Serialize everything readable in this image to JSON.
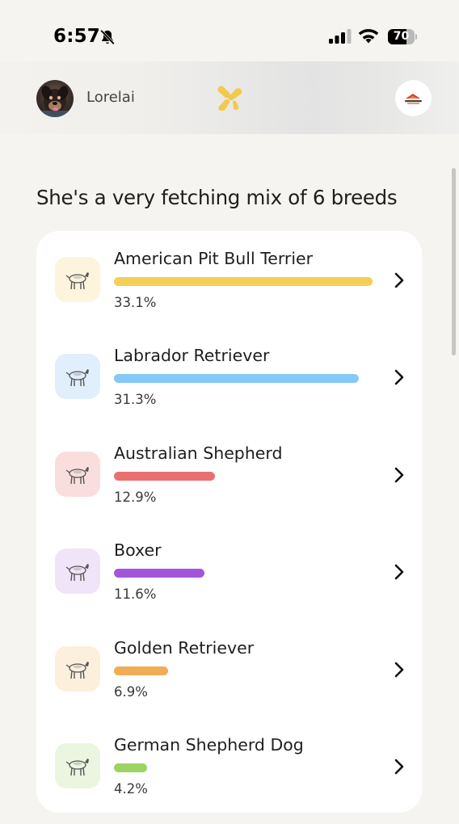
{
  "status_bar": {
    "time": "6:57",
    "battery_level": "70",
    "battery_fraction": 0.7
  },
  "header": {
    "owner_name": "Lorelai",
    "logo_icon": "balloon-dog-logo-icon",
    "logo_color": "#f2c94c"
  },
  "main": {
    "title": "She's a very fetching mix of 6 breeds",
    "breeds": [
      {
        "name": "American Pit Bull Terrier",
        "percent_label": "33.1%",
        "percent": 33.1,
        "bar_color": "#f2cf56",
        "tile_color": "#fcf4dc"
      },
      {
        "name": "Labrador Retriever",
        "percent_label": "31.3%",
        "percent": 31.3,
        "bar_color": "#86c8f6",
        "tile_color": "#e1eefb"
      },
      {
        "name": "Australian Shepherd",
        "percent_label": "12.9%",
        "percent": 12.9,
        "bar_color": "#ea7070",
        "tile_color": "#fadede"
      },
      {
        "name": "Boxer",
        "percent_label": "11.6%",
        "percent": 11.6,
        "bar_color": "#a356d9",
        "tile_color": "#f0e4f8"
      },
      {
        "name": "Golden Retriever",
        "percent_label": "6.9%",
        "percent": 6.9,
        "bar_color": "#f0ad55",
        "tile_color": "#fcefdc"
      },
      {
        "name": "German Shepherd Dog",
        "percent_label": "4.2%",
        "percent": 4.2,
        "bar_color": "#9bd462",
        "tile_color": "#eaf6e0"
      }
    ]
  }
}
